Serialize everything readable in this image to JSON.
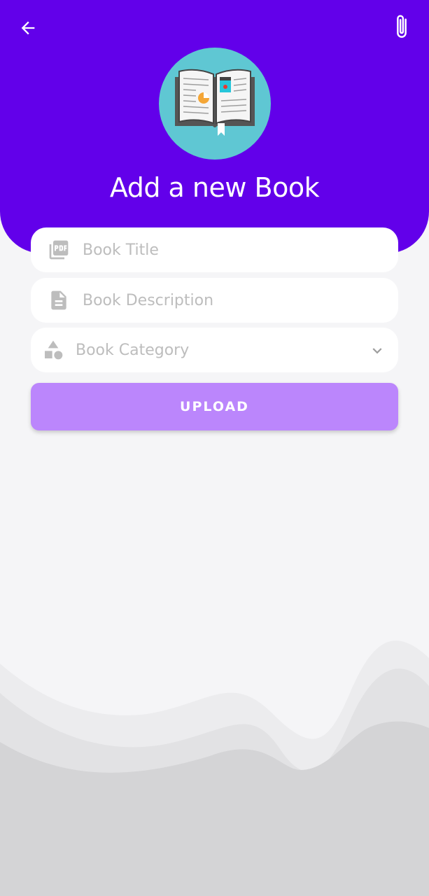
{
  "header": {
    "title": "Add a new Book",
    "back_icon": "arrow-back-icon",
    "attach_icon": "paperclip-icon",
    "book_illustration": "open-book-icon",
    "background_color": "#6200ea",
    "circle_color": "#5fc7d3"
  },
  "form": {
    "title_placeholder": "Book Title",
    "title_icon": "pdf-icon",
    "description_placeholder": "Book Description",
    "description_icon": "document-icon",
    "category_placeholder": "Book Category",
    "category_icon": "shapes-icon",
    "category_dropdown_icon": "chevron-down-icon"
  },
  "actions": {
    "upload_label": "UPLOAD",
    "upload_color": "#bb86fc"
  }
}
